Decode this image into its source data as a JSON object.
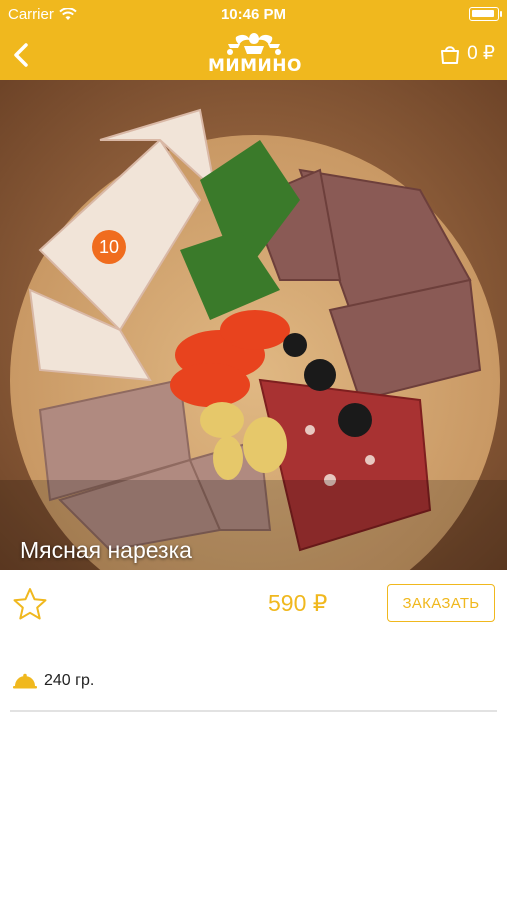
{
  "status_bar": {
    "carrier": "Carrier",
    "time": "10:46 PM"
  },
  "nav": {
    "logo_text": "МИМИНО",
    "cart_total": "0 ₽"
  },
  "product": {
    "title": "Мясная нарезка",
    "badge": "10",
    "price": "590 ₽",
    "order_label": "ЗАКАЗАТЬ",
    "weight": "240 гр."
  },
  "colors": {
    "accent": "#f0b81e",
    "badge": "#f06c1e",
    "divider": "#e2e2e2"
  },
  "icons": [
    "wifi-icon",
    "battery-icon",
    "back-icon",
    "logo-icon",
    "cart-icon",
    "star-icon",
    "dish-icon"
  ]
}
